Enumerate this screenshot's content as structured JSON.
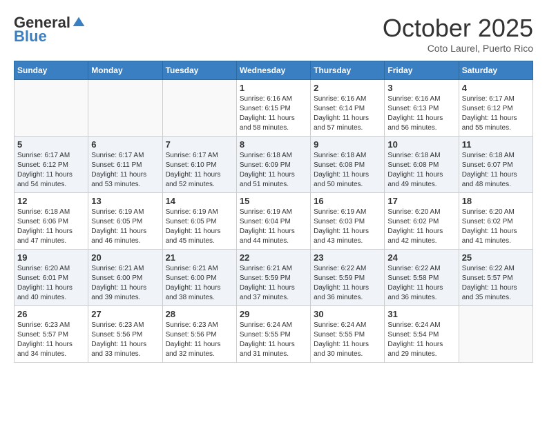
{
  "header": {
    "logo_general": "General",
    "logo_blue": "Blue",
    "month_title": "October 2025",
    "location": "Coto Laurel, Puerto Rico"
  },
  "weekdays": [
    "Sunday",
    "Monday",
    "Tuesday",
    "Wednesday",
    "Thursday",
    "Friday",
    "Saturday"
  ],
  "weeks": [
    [
      {
        "day": "",
        "info": ""
      },
      {
        "day": "",
        "info": ""
      },
      {
        "day": "",
        "info": ""
      },
      {
        "day": "1",
        "info": "Sunrise: 6:16 AM\nSunset: 6:15 PM\nDaylight: 11 hours and 58 minutes."
      },
      {
        "day": "2",
        "info": "Sunrise: 6:16 AM\nSunset: 6:14 PM\nDaylight: 11 hours and 57 minutes."
      },
      {
        "day": "3",
        "info": "Sunrise: 6:16 AM\nSunset: 6:13 PM\nDaylight: 11 hours and 56 minutes."
      },
      {
        "day": "4",
        "info": "Sunrise: 6:17 AM\nSunset: 6:12 PM\nDaylight: 11 hours and 55 minutes."
      }
    ],
    [
      {
        "day": "5",
        "info": "Sunrise: 6:17 AM\nSunset: 6:12 PM\nDaylight: 11 hours and 54 minutes."
      },
      {
        "day": "6",
        "info": "Sunrise: 6:17 AM\nSunset: 6:11 PM\nDaylight: 11 hours and 53 minutes."
      },
      {
        "day": "7",
        "info": "Sunrise: 6:17 AM\nSunset: 6:10 PM\nDaylight: 11 hours and 52 minutes."
      },
      {
        "day": "8",
        "info": "Sunrise: 6:18 AM\nSunset: 6:09 PM\nDaylight: 11 hours and 51 minutes."
      },
      {
        "day": "9",
        "info": "Sunrise: 6:18 AM\nSunset: 6:08 PM\nDaylight: 11 hours and 50 minutes."
      },
      {
        "day": "10",
        "info": "Sunrise: 6:18 AM\nSunset: 6:08 PM\nDaylight: 11 hours and 49 minutes."
      },
      {
        "day": "11",
        "info": "Sunrise: 6:18 AM\nSunset: 6:07 PM\nDaylight: 11 hours and 48 minutes."
      }
    ],
    [
      {
        "day": "12",
        "info": "Sunrise: 6:18 AM\nSunset: 6:06 PM\nDaylight: 11 hours and 47 minutes."
      },
      {
        "day": "13",
        "info": "Sunrise: 6:19 AM\nSunset: 6:05 PM\nDaylight: 11 hours and 46 minutes."
      },
      {
        "day": "14",
        "info": "Sunrise: 6:19 AM\nSunset: 6:05 PM\nDaylight: 11 hours and 45 minutes."
      },
      {
        "day": "15",
        "info": "Sunrise: 6:19 AM\nSunset: 6:04 PM\nDaylight: 11 hours and 44 minutes."
      },
      {
        "day": "16",
        "info": "Sunrise: 6:19 AM\nSunset: 6:03 PM\nDaylight: 11 hours and 43 minutes."
      },
      {
        "day": "17",
        "info": "Sunrise: 6:20 AM\nSunset: 6:02 PM\nDaylight: 11 hours and 42 minutes."
      },
      {
        "day": "18",
        "info": "Sunrise: 6:20 AM\nSunset: 6:02 PM\nDaylight: 11 hours and 41 minutes."
      }
    ],
    [
      {
        "day": "19",
        "info": "Sunrise: 6:20 AM\nSunset: 6:01 PM\nDaylight: 11 hours and 40 minutes."
      },
      {
        "day": "20",
        "info": "Sunrise: 6:21 AM\nSunset: 6:00 PM\nDaylight: 11 hours and 39 minutes."
      },
      {
        "day": "21",
        "info": "Sunrise: 6:21 AM\nSunset: 6:00 PM\nDaylight: 11 hours and 38 minutes."
      },
      {
        "day": "22",
        "info": "Sunrise: 6:21 AM\nSunset: 5:59 PM\nDaylight: 11 hours and 37 minutes."
      },
      {
        "day": "23",
        "info": "Sunrise: 6:22 AM\nSunset: 5:59 PM\nDaylight: 11 hours and 36 minutes."
      },
      {
        "day": "24",
        "info": "Sunrise: 6:22 AM\nSunset: 5:58 PM\nDaylight: 11 hours and 36 minutes."
      },
      {
        "day": "25",
        "info": "Sunrise: 6:22 AM\nSunset: 5:57 PM\nDaylight: 11 hours and 35 minutes."
      }
    ],
    [
      {
        "day": "26",
        "info": "Sunrise: 6:23 AM\nSunset: 5:57 PM\nDaylight: 11 hours and 34 minutes."
      },
      {
        "day": "27",
        "info": "Sunrise: 6:23 AM\nSunset: 5:56 PM\nDaylight: 11 hours and 33 minutes."
      },
      {
        "day": "28",
        "info": "Sunrise: 6:23 AM\nSunset: 5:56 PM\nDaylight: 11 hours and 32 minutes."
      },
      {
        "day": "29",
        "info": "Sunrise: 6:24 AM\nSunset: 5:55 PM\nDaylight: 11 hours and 31 minutes."
      },
      {
        "day": "30",
        "info": "Sunrise: 6:24 AM\nSunset: 5:55 PM\nDaylight: 11 hours and 30 minutes."
      },
      {
        "day": "31",
        "info": "Sunrise: 6:24 AM\nSunset: 5:54 PM\nDaylight: 11 hours and 29 minutes."
      },
      {
        "day": "",
        "info": ""
      }
    ]
  ]
}
